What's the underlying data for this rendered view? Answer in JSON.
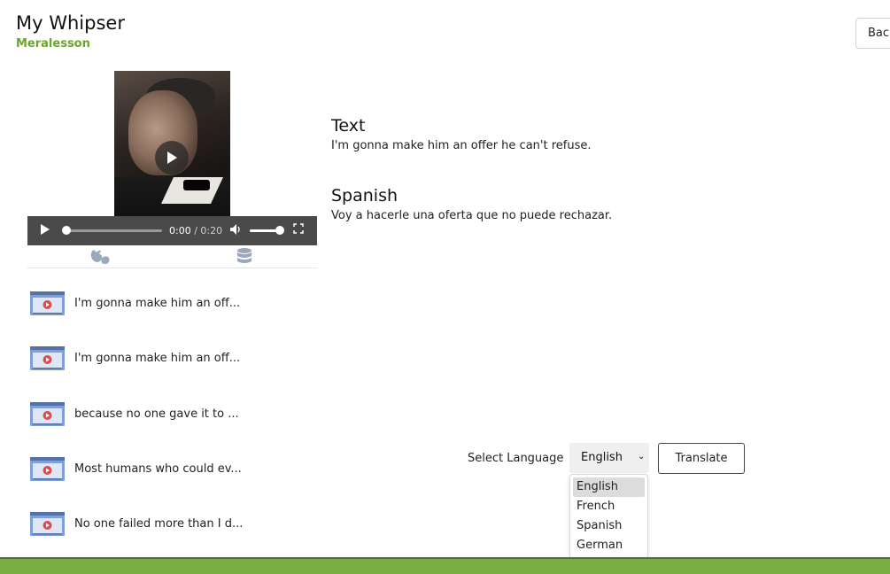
{
  "header": {
    "title": "My Whipser",
    "subtitle": "Meralesson",
    "back_label": "Back"
  },
  "video": {
    "current_time": "0:00",
    "separator": " / ",
    "duration": "0:20",
    "progress": 0.0,
    "volume": 1.0
  },
  "clips": [
    {
      "label": "I'm gonna make him an off..."
    },
    {
      "label": "I'm gonna make him an off..."
    },
    {
      "label": "because no one gave it to ..."
    },
    {
      "label": "Most humans who could ev..."
    },
    {
      "label": "No one failed more than I d..."
    }
  ],
  "text_section": {
    "title": "Text",
    "body": "I'm gonna make him an offer he can't refuse."
  },
  "translation_section": {
    "title": "Spanish",
    "body": "Voy a hacerle una oferta que no puede rechazar."
  },
  "language_picker": {
    "label": "Select Language",
    "selected": "English",
    "options": [
      "English",
      "French",
      "Spanish",
      "German"
    ]
  },
  "translate_label": "Translate",
  "colors": {
    "accent": "#6aa526",
    "footer": "#7bae42",
    "thumb": "#7f9fd9"
  },
  "icons": {
    "sign_language": "sign-language-icon",
    "database": "database-icon",
    "clip_thumbnail": "video-file-icon"
  }
}
